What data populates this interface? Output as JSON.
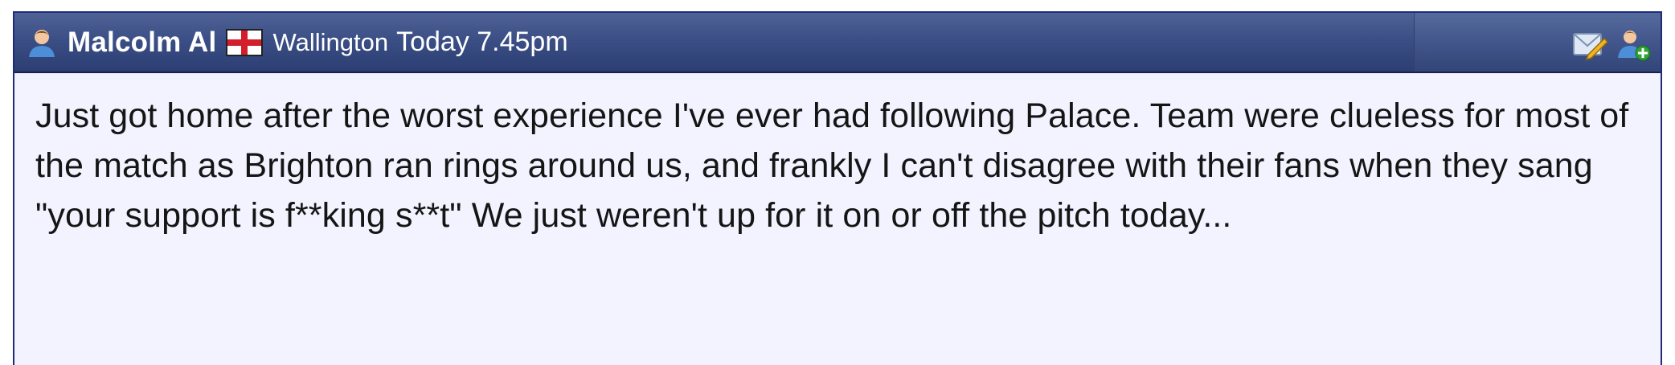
{
  "post": {
    "author": "Malcolm Al",
    "location": "Wallington",
    "timestamp": "Today 7.45pm",
    "body": "Just got home after the worst experience I've ever had following Palace. Team were clueless for most of the match as Brighton ran rings around us, and frankly I can't disagree with their fans when they sang \"your support is f**king s**t\" We just weren't up for it on or off the pitch today..."
  },
  "icons": {
    "author": "user-icon",
    "flag": "england-flag-icon",
    "message": "send-message-icon",
    "add_friend": "add-user-icon"
  },
  "colors": {
    "header": "#3b4f86",
    "border": "#1f2b78",
    "body_background": "#f2f3ff",
    "text": "#151515"
  }
}
